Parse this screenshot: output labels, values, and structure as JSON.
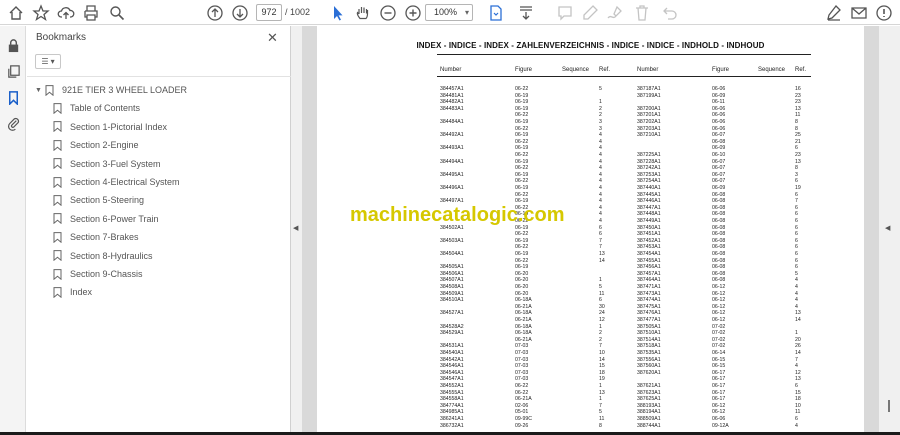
{
  "toolbar": {
    "current_page": "972",
    "separator": "/",
    "total_pages": "1002",
    "zoom": "100%"
  },
  "bookmarks": {
    "title": "Bookmarks",
    "items": [
      {
        "label": "921E TIER 3 WHEEL LOADER"
      },
      {
        "label": "Table of Contents"
      },
      {
        "label": "Section 1-Pictorial Index"
      },
      {
        "label": "Section 2-Engine"
      },
      {
        "label": "Section 3-Fuel System"
      },
      {
        "label": "Section 4-Electrical System"
      },
      {
        "label": "Section 5-Steering"
      },
      {
        "label": "Section 6-Power Train"
      },
      {
        "label": "Section 7-Brakes"
      },
      {
        "label": "Section 8-Hydraulics"
      },
      {
        "label": "Section 9-Chassis"
      },
      {
        "label": "Index"
      }
    ]
  },
  "document": {
    "title": "INDEX - INDICE - INDEX - ZAHLENVERZEICHNIS - INDICE - INDICE - INDHOLD - INDHOUD",
    "headers": [
      "Number",
      "Figure",
      "Sequence",
      "Ref.",
      "Number",
      "Figure",
      "Sequence",
      "Ref."
    ],
    "watermark": "machinecatalogic.com",
    "left_col": [
      [
        "384457A1",
        "06-22",
        "5"
      ],
      [
        "384481A1",
        "06-19",
        ""
      ],
      [
        "384482A1",
        "06-19",
        "1"
      ],
      [
        "384483A1",
        "06-19",
        "2"
      ],
      [
        "",
        "06-22",
        "2"
      ],
      [
        "384484A1",
        "06-19",
        "3"
      ],
      [
        "",
        "06-22",
        "3"
      ],
      [
        "384492A1",
        "06-19",
        "4"
      ],
      [
        "",
        "06-22",
        "4"
      ],
      [
        "384493A1",
        "06-19",
        "4"
      ],
      [
        "",
        "06-22",
        "4"
      ],
      [
        "384494A1",
        "06-19",
        "4"
      ],
      [
        "",
        "06-22",
        "4"
      ],
      [
        "384495A1",
        "06-19",
        "4"
      ],
      [
        "",
        "06-22",
        "4"
      ],
      [
        "384496A1",
        "06-19",
        "4"
      ],
      [
        "",
        "06-22",
        "4"
      ],
      [
        "384497A1",
        "06-19",
        "4"
      ],
      [
        "",
        "06-22",
        "4"
      ],
      [
        "",
        "06-19",
        "4"
      ],
      [
        "",
        "06-22",
        "4"
      ],
      [
        "384502A1",
        "06-19",
        "6"
      ],
      [
        "",
        "06-22",
        "6"
      ],
      [
        "384503A1",
        "06-19",
        "7"
      ],
      [
        "",
        "06-22",
        "7"
      ],
      [
        "384504A1",
        "06-19",
        "13"
      ],
      [
        "",
        "06-22",
        "14"
      ],
      [
        "384505A1",
        "06-19",
        ""
      ],
      [
        "384506A1",
        "06-20",
        ""
      ],
      [
        "384507A1",
        "06-20",
        "1"
      ],
      [
        "384508A1",
        "06-20",
        "5"
      ],
      [
        "384509A1",
        "06-20",
        "11"
      ],
      [
        "384510A1",
        "06-18A",
        "6"
      ],
      [
        "",
        "06-21A",
        "30"
      ],
      [
        "384527A1",
        "06-18A",
        "24"
      ],
      [
        "",
        "06-21A",
        "12"
      ],
      [
        "384528A2",
        "06-18A",
        "1"
      ],
      [
        "384529A1",
        "06-18A",
        "2"
      ],
      [
        "",
        "06-21A",
        "2"
      ],
      [
        "384531A1",
        "07-03",
        "7"
      ],
      [
        "384540A1",
        "07-03",
        "10"
      ],
      [
        "384542A1",
        "07-03",
        "14"
      ],
      [
        "384546A1",
        "07-03",
        "15"
      ],
      [
        "384546A1",
        "07-03",
        "18"
      ],
      [
        "384547A1",
        "07-03",
        "19"
      ],
      [
        "384552A1",
        "06-22",
        "1"
      ],
      [
        "384555A1",
        "06-22",
        "13"
      ],
      [
        "384558A1",
        "06-21A",
        "1"
      ],
      [
        "384774A1",
        "02-06",
        "7"
      ],
      [
        "384985A1",
        "05-01",
        "5"
      ],
      [
        "386241A1",
        "09-99C",
        "11"
      ],
      [
        "386732A1",
        "09-26",
        "8"
      ]
    ],
    "right_col": [
      [
        "387187A1",
        "06-06",
        "16"
      ],
      [
        "387199A1",
        "06-09",
        "23"
      ],
      [
        "",
        "06-11",
        "23"
      ],
      [
        "387200A1",
        "06-06",
        "13"
      ],
      [
        "387201A1",
        "06-06",
        "11"
      ],
      [
        "387202A1",
        "06-06",
        "8"
      ],
      [
        "387203A1",
        "06-06",
        "8"
      ],
      [
        "387210A1",
        "06-07",
        "25"
      ],
      [
        "",
        "06-08",
        "21"
      ],
      [
        "",
        "06-09",
        "6"
      ],
      [
        "387225A1",
        "06-10",
        "23"
      ],
      [
        "387228A1",
        "06-07",
        "13"
      ],
      [
        "387242A1",
        "06-07",
        "8"
      ],
      [
        "387253A1",
        "06-07",
        "3"
      ],
      [
        "387254A1",
        "06-07",
        "6"
      ],
      [
        "387440A1",
        "06-09",
        "19"
      ],
      [
        "387445A1",
        "06-08",
        "6"
      ],
      [
        "387446A1",
        "06-08",
        "7"
      ],
      [
        "387447A1",
        "06-08",
        "6"
      ],
      [
        "387448A1",
        "06-08",
        "6"
      ],
      [
        "387449A1",
        "06-08",
        "6"
      ],
      [
        "387450A1",
        "06-08",
        "6"
      ],
      [
        "387451A1",
        "06-08",
        "6"
      ],
      [
        "387452A1",
        "06-08",
        "6"
      ],
      [
        "387453A1",
        "06-08",
        "6"
      ],
      [
        "387454A1",
        "06-08",
        "6"
      ],
      [
        "387455A1",
        "06-08",
        "6"
      ],
      [
        "387456A1",
        "06-08",
        "6"
      ],
      [
        "387457A1",
        "06-08",
        "5"
      ],
      [
        "387464A1",
        "06-08",
        "4"
      ],
      [
        "387471A1",
        "06-12",
        "4"
      ],
      [
        "387473A1",
        "06-12",
        "4"
      ],
      [
        "387474A1",
        "06-12",
        "4"
      ],
      [
        "387475A1",
        "06-12",
        "4"
      ],
      [
        "387476A1",
        "06-12",
        "13"
      ],
      [
        "387477A1",
        "06-12",
        "14"
      ],
      [
        "387505A1",
        "07-02",
        ""
      ],
      [
        "387510A1",
        "07-02",
        "1"
      ],
      [
        "387514A1",
        "07-02",
        "20"
      ],
      [
        "387518A1",
        "07-02",
        "26"
      ],
      [
        "387535A1",
        "06-14",
        "14"
      ],
      [
        "387556A1",
        "06-15",
        "7"
      ],
      [
        "387560A1",
        "06-15",
        "4"
      ],
      [
        "387620A1",
        "06-17",
        "12"
      ],
      [
        "",
        "06-17",
        "13"
      ],
      [
        "387621A1",
        "06-17",
        "6"
      ],
      [
        "387623A1",
        "06-17",
        "15"
      ],
      [
        "387625A1",
        "06-17",
        "18"
      ],
      [
        "388193A1",
        "06-12",
        "10"
      ],
      [
        "388194A1",
        "06-12",
        "11"
      ],
      [
        "388509A1",
        "06-06",
        "6"
      ],
      [
        "388744A1",
        "09-12A",
        "4"
      ]
    ]
  }
}
